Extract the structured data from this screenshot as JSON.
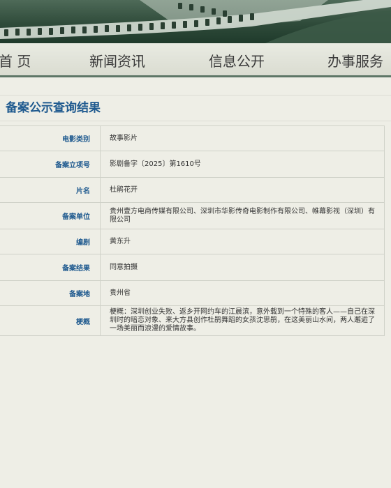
{
  "nav": {
    "items": [
      {
        "label": "首 页"
      },
      {
        "label": "新闻资讯"
      },
      {
        "label": "信息公开"
      },
      {
        "label": "办事服务"
      }
    ]
  },
  "section": {
    "title": "备案公示查询结果"
  },
  "record": {
    "rows": [
      {
        "label": "电影类别",
        "value": "故事影片"
      },
      {
        "label": "备案立项号",
        "value": "影剧备字〔2025〕第1610号"
      },
      {
        "label": "片名",
        "value": "杜鹃花开"
      },
      {
        "label": "备案单位",
        "value": "贵州壹方电商传媒有限公司、深圳市华影传奇电影制作有限公司、帷幕影视（深圳）有限公司"
      },
      {
        "label": "编剧",
        "value": "黄东升"
      },
      {
        "label": "备案结果",
        "value": "同意拍摄"
      },
      {
        "label": "备案地",
        "value": "贵州省"
      },
      {
        "label": "梗概",
        "value": "梗概：深圳创业失败、返乡开网约车的江晨滨，意外载到一个特殊的客人——自己在深圳时的暗恋对象、来大方县创作杜鹃舞蹈的女孩沈思鹃，在这美丽山水间，两人邂逅了一场美丽而浪漫的爱情故事。"
      }
    ]
  },
  "colors": {
    "banner": "#2f4b3a",
    "nav_border": "#5d7666",
    "label_text": "#1f5a8f",
    "page_bg": "#eeeee6"
  }
}
